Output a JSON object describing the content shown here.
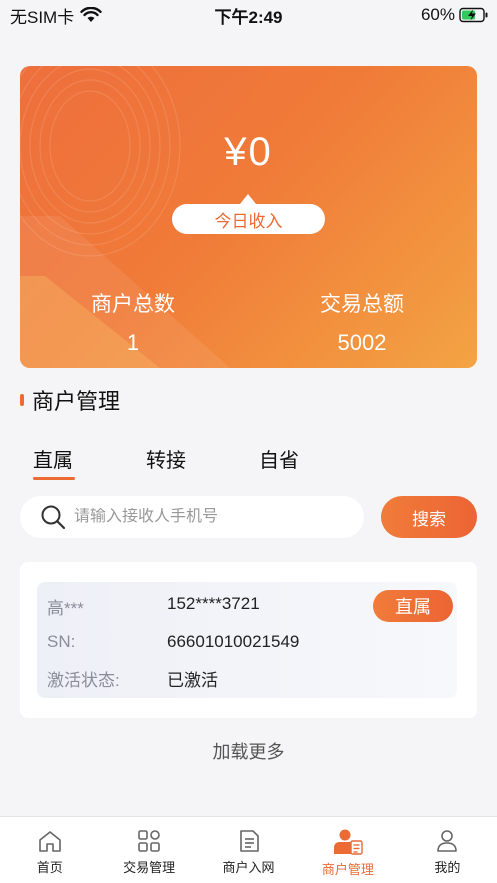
{
  "status_bar": {
    "carrier": "无SIM卡",
    "time": "下午2:49",
    "battery": "60%",
    "icons": [
      "wifi-icon",
      "battery-charging-icon"
    ]
  },
  "hero": {
    "amount": "¥0",
    "today_income_label": "今日收入",
    "merchant_count_label": "商户总数",
    "merchant_count": "1",
    "trade_total_label": "交易总额",
    "trade_total": "5002"
  },
  "section": {
    "title": "商户管理"
  },
  "tabs": [
    {
      "label": "直属",
      "active": true
    },
    {
      "label": "转接",
      "active": false
    },
    {
      "label": "自省",
      "active": false
    }
  ],
  "search": {
    "placeholder": "请输入接收人手机号",
    "value": "",
    "button_label": "搜索"
  },
  "merchant": {
    "name": "高***",
    "phone": "152****3721",
    "badge": "直属",
    "sn_label": "SN:",
    "sn": "66601010021549",
    "status_label": "激活状态:",
    "status": "已激活"
  },
  "load_more": "加载更多",
  "tab_bar": [
    {
      "label": "首页",
      "icon": "home-icon",
      "active": false
    },
    {
      "label": "交易管理",
      "icon": "grid-icon",
      "active": false
    },
    {
      "label": "商户入网",
      "icon": "document-icon",
      "active": false
    },
    {
      "label": "商户管理",
      "icon": "merchant-manage-icon",
      "active": true
    },
    {
      "label": "我的",
      "icon": "user-icon",
      "active": false
    }
  ],
  "colors": {
    "accent": "#ec6a34",
    "background": "#f5f5f7"
  }
}
